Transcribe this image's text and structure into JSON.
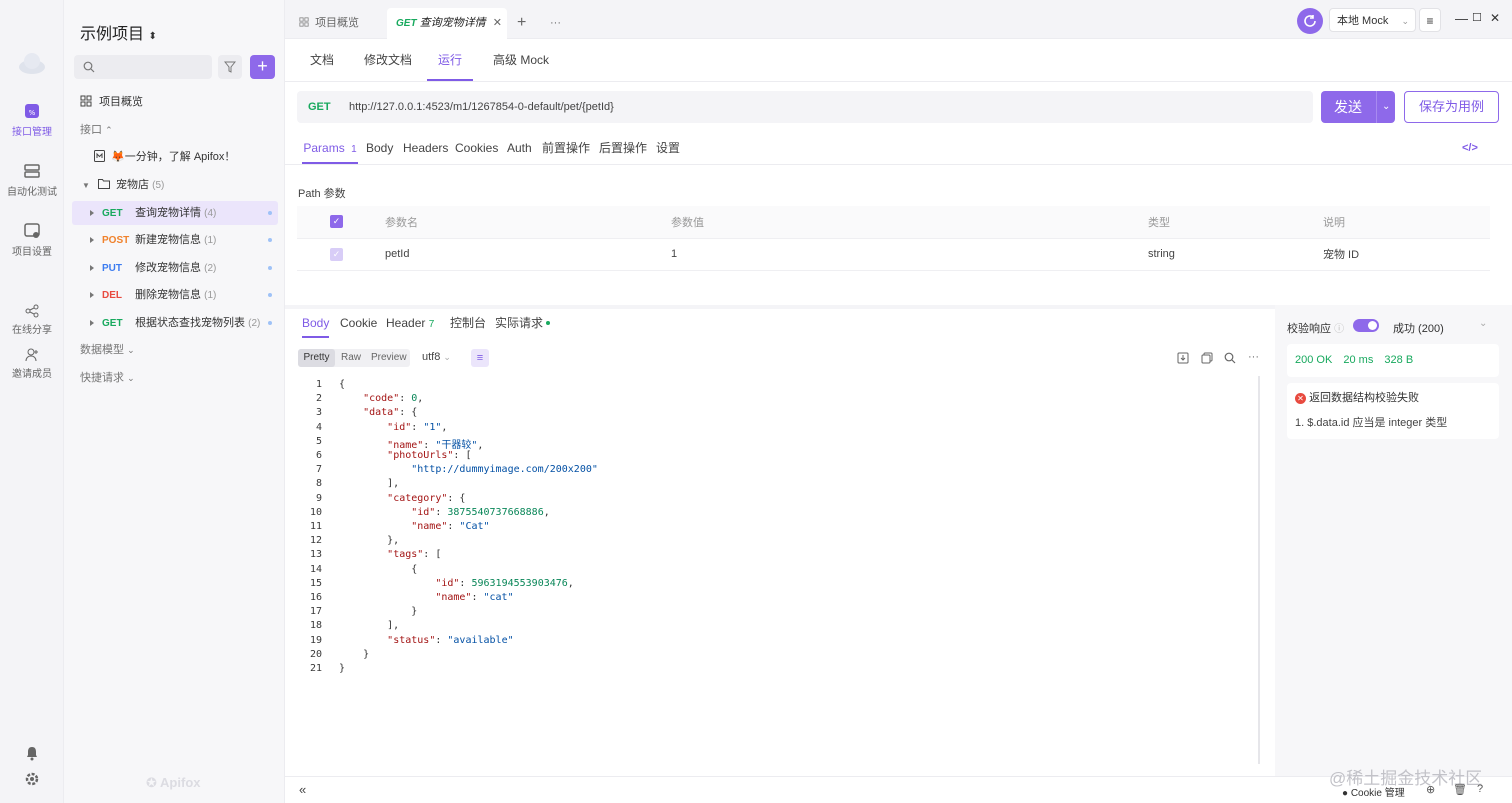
{
  "rail": {
    "items": [
      {
        "label": "接口管理",
        "icon": "api-icon"
      },
      {
        "label": "自动化测试",
        "icon": "automation-icon"
      },
      {
        "label": "项目设置",
        "icon": "settings-icon"
      },
      {
        "label": "在线分享",
        "icon": "share-icon"
      },
      {
        "label": "邀请成员",
        "icon": "invite-icon"
      }
    ]
  },
  "sidebar": {
    "project": "示例项目",
    "overview": "项目概览",
    "api_section": "接口",
    "intro": "🦊一分钟，了解 Apifox！",
    "folder": "宠物店",
    "folder_count": "(5)",
    "apis": [
      {
        "method": "GET",
        "name": "查询宠物详情",
        "count": "(4)"
      },
      {
        "method": "POST",
        "name": "新建宠物信息",
        "count": "(1)"
      },
      {
        "method": "PUT",
        "name": "修改宠物信息",
        "count": "(2)"
      },
      {
        "method": "DEL",
        "name": "删除宠物信息",
        "count": "(1)"
      },
      {
        "method": "GET",
        "name": "根据状态查找宠物列表",
        "count": "(2)"
      }
    ],
    "data_model": "数据模型",
    "quick_request": "快捷请求",
    "watermark": "Apifox"
  },
  "tabs": {
    "overview": "项目概览",
    "active_method": "GET",
    "active_name": "查询宠物详情",
    "more": "···"
  },
  "env": {
    "label": "本地 Mock"
  },
  "subtabs": [
    "文档",
    "修改文档",
    "运行",
    "高级 Mock"
  ],
  "request": {
    "method": "GET",
    "url": "http://127.0.0.1:4523/m1/1267854-0-default/pet/{petId}",
    "send": "发送",
    "save": "保存为用例"
  },
  "param_tabs": {
    "params": "Params",
    "params_count": "1",
    "others": [
      "Body",
      "Headers",
      "Cookies",
      "Auth",
      "前置操作",
      "后置操作",
      "设置"
    ]
  },
  "path_params": {
    "title": "Path 参数",
    "headers": [
      "参数名",
      "参数值",
      "类型",
      "说明"
    ],
    "rows": [
      {
        "name": "petId",
        "value": "1",
        "type": "string",
        "desc": "宠物 ID"
      }
    ]
  },
  "response": {
    "tabs": [
      "Body",
      "Cookie",
      "Header",
      "控制台",
      "实际请求"
    ],
    "header_count": "7",
    "formats": [
      "Pretty",
      "Raw",
      "Preview"
    ],
    "encoding": "utf8",
    "lines": [
      "{",
      "    \"code\": 0,",
      "    \"data\": {",
      "        \"id\": \"1\",",
      "        \"name\": \"干器较\",",
      "        \"photoUrls\": [",
      "            \"http://dummyimage.com/200x200\"",
      "        ],",
      "        \"category\": {",
      "            \"id\": 3875540737668886,",
      "            \"name\": \"Cat\"",
      "        },",
      "        \"tags\": [",
      "            {",
      "                \"id\": 5963194553903476,",
      "                \"name\": \"cat\"",
      "            }",
      "        ],",
      "        \"status\": \"available\"",
      "    }",
      "}"
    ]
  },
  "validation": {
    "label": "校验响应",
    "result": "成功 (200)",
    "status": "200 OK",
    "time": "20 ms",
    "size": "328 B",
    "error_title": "返回数据结构校验失败",
    "error_detail": "1. $.data.id 应当是 integer 类型"
  },
  "bottom": {
    "cookie": "Cookie 管理",
    "watermark": "@稀土掘金技术社区"
  },
  "colors": {
    "accent": "#8e69ea",
    "get": "#18a95e",
    "post": "#f0822c",
    "put": "#3c7cf0",
    "del": "#e84a3f"
  }
}
